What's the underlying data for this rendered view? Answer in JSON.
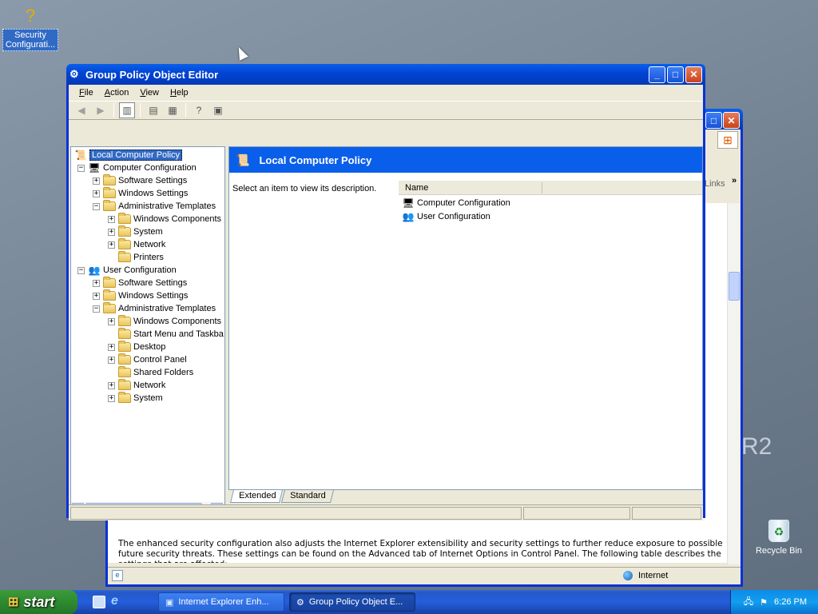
{
  "desktop": {
    "icon_security": "Security Configurati...",
    "icon_recycle": "Recycle Bin",
    "bg_watermark": "R2"
  },
  "ie_window": {
    "links_label": "Links",
    "body_text": "The enhanced security configuration also adjusts the Internet Explorer extensibility and security settings to further reduce exposure to possible future security threats. These settings can be found on the Advanced tab of Internet Options in Control Panel. The following table describes the settings that are affected:",
    "status_zone": "Internet"
  },
  "gpo_window": {
    "title": "Group Policy Object Editor",
    "menu": [
      "File",
      "Action",
      "View",
      "Help"
    ],
    "tree": {
      "root": "Local Computer Policy",
      "computer_config": "Computer Configuration",
      "cc_software": "Software Settings",
      "cc_windows": "Windows Settings",
      "cc_admin": "Administrative Templates",
      "cc_admin_wincomp": "Windows Components",
      "cc_admin_system": "System",
      "cc_admin_network": "Network",
      "cc_admin_printers": "Printers",
      "user_config": "User Configuration",
      "uc_software": "Software Settings",
      "uc_windows": "Windows Settings",
      "uc_admin": "Administrative Templates",
      "uc_admin_wincomp": "Windows Components",
      "uc_admin_start": "Start Menu and Taskba",
      "uc_admin_desktop": "Desktop",
      "uc_admin_control": "Control Panel",
      "uc_admin_shared": "Shared Folders",
      "uc_admin_network": "Network",
      "uc_admin_system": "System"
    },
    "right": {
      "header": "Local Computer Policy",
      "description": "Select an item to view its description.",
      "column_name": "Name",
      "items": [
        "Computer Configuration",
        "User Configuration"
      ]
    },
    "tabs": [
      "Extended",
      "Standard"
    ]
  },
  "taskbar": {
    "start": "start",
    "items": [
      "Internet Explorer Enh...",
      "Group Policy Object E..."
    ],
    "clock": "6:26 PM"
  }
}
